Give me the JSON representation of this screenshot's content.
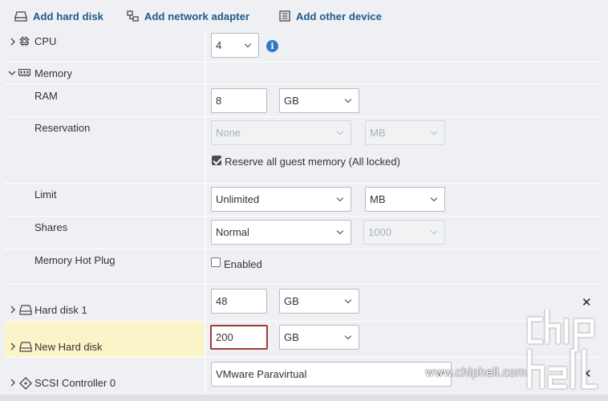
{
  "toolbar": {
    "add_hard_disk": "Add hard disk",
    "add_network_adapter": "Add network adapter",
    "add_other_device": "Add other device"
  },
  "rows": {
    "cpu": {
      "label": "CPU",
      "value": "4"
    },
    "memory": {
      "label": "Memory"
    },
    "ram": {
      "label": "RAM",
      "value": "8",
      "unit": "GB"
    },
    "reservation": {
      "label": "Reservation",
      "value": "None",
      "unit": "MB",
      "checkbox_label": "Reserve all guest memory (All locked)",
      "checked": true
    },
    "limit": {
      "label": "Limit",
      "value": "Unlimited",
      "unit": "MB"
    },
    "shares": {
      "label": "Shares",
      "value": "Normal",
      "amount": "1000"
    },
    "hot_plug": {
      "label": "Memory Hot Plug",
      "checkbox_label": "Enabled",
      "checked": false
    },
    "hard_disk_1": {
      "label": "Hard disk 1",
      "value": "48",
      "unit": "GB"
    },
    "new_hard_disk": {
      "label": "New Hard disk",
      "value": "200",
      "unit": "GB"
    },
    "scsi": {
      "label": "SCSI Controller 0",
      "value": "VMware Paravirtual"
    }
  },
  "watermark": {
    "text": "www.chiphell.com",
    "logo_text": "chip hell"
  },
  "colors": {
    "accent_link": "#1d5a8a",
    "highlight_row": "#fcf4c9",
    "error_border": "#a33a32",
    "info_icon": "#2f79c2"
  }
}
